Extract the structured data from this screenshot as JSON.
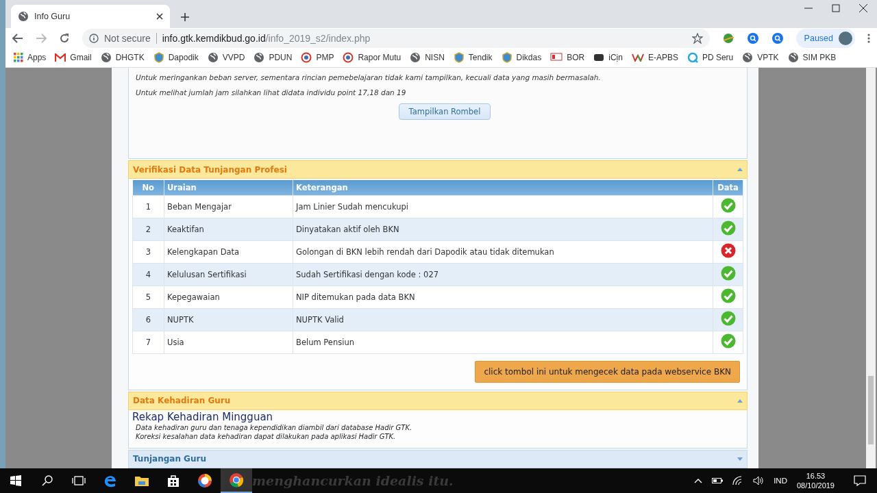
{
  "tabs": [
    {
      "title": "Info Guru",
      "selected": true
    }
  ],
  "address": {
    "security": "Not secure",
    "host": "info.gtk.kemdikbud.go.id",
    "path": "/info_2019_s2/index.php"
  },
  "profile": {
    "status": "Paused"
  },
  "bookmarks": [
    "Apps",
    "Gmail",
    "DHGTK",
    "Dapodik",
    "VVPD",
    "PDUN",
    "PMP",
    "Rapor Mutu",
    "NISN",
    "Tendik",
    "Dikdas",
    "BOR",
    "iCịn",
    "E-APBS",
    "PD Seru",
    "VPTK",
    "SIM PKB"
  ],
  "notes": [
    "Untuk meringankan beban server, sementara rincian pemebelajaran tidak kami tampilkan, kecuali data yang masih bermasalah.",
    "Untuk melihat jumlah jam silahkan lihat didata individu point 17,18 dan 19"
  ],
  "rombel_button": "Tampilkan Rombel",
  "verification": {
    "title": "Verifikasi Data Tunjangan Profesi",
    "expanded": true,
    "columns": [
      "No",
      "Uraian",
      "Keterangan",
      "Data"
    ],
    "rows": [
      {
        "no": "1",
        "item": "Beban Mengajar",
        "note": "Jam Linier Sudah mencukupi",
        "valid": true
      },
      {
        "no": "2",
        "item": "Keaktifan",
        "note": "Dinyatakan aktif oleh BKN",
        "valid": true
      },
      {
        "no": "3",
        "item": "Kelengkapan Data",
        "note": "Golongan di BKN lebih rendah dari Dapodik atau tidak ditemukan",
        "valid": false
      },
      {
        "no": "4",
        "item": "Kelulusan Sertifikasi",
        "note": "Sudah Sertifikasi dengan kode : 027",
        "valid": true
      },
      {
        "no": "5",
        "item": "Kepegawaian",
        "note": "NIP ditemukan pada data BKN",
        "valid": true
      },
      {
        "no": "6",
        "item": "NUPTK",
        "note": "NUPTK Valid",
        "valid": true
      },
      {
        "no": "7",
        "item": "Usia",
        "note": "Belum Pensiun",
        "valid": true
      }
    ],
    "check_button": "click tombol ini untuk mengecek data pada webservice BKN"
  },
  "attendance": {
    "title": "Data Kehadiran Guru",
    "expanded": true,
    "heading": "Rekap Kehadiran Mingguan",
    "lines": [
      "Data kehadiran guru dan tenaga kependidikan diambil dari database Hadir GTK.",
      "Koreksi kesalahan data kehadiran dapat dilakukan pada aplikasi Hadir GTK."
    ]
  },
  "allowance": {
    "title": "Tunjangan Guru",
    "expanded": false
  },
  "desktop_text": "menghancurkan idealis itu.",
  "taskbar": {
    "language": "IND",
    "time": "16.53",
    "date": "08/10/2019"
  }
}
